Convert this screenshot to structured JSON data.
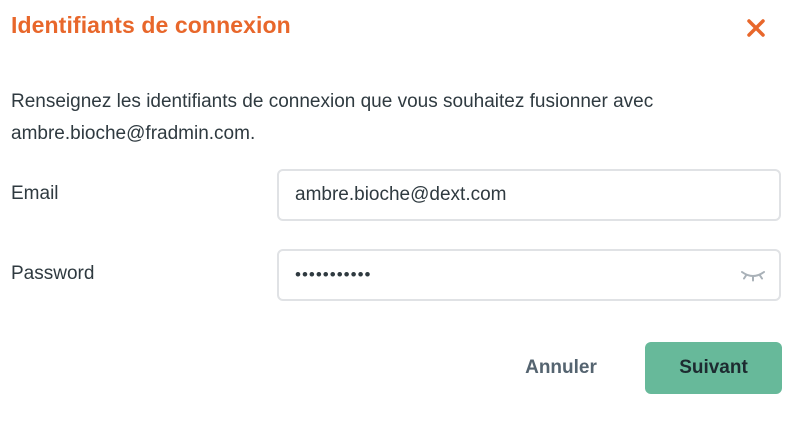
{
  "dialog": {
    "title": "Identifiants de connexion",
    "close_icon": "close-icon",
    "description": "Renseignez les identifiants de connexion que vous souhaitez fusionner avec ambre.bioche@fradmin.com."
  },
  "form": {
    "email_label": "Email",
    "email_value": "ambre.bioche@dext.com",
    "password_label": "Password",
    "password_masked": "•••••••••••",
    "password_toggle_icon": "eye-closed-icon"
  },
  "actions": {
    "cancel_label": "Annuler",
    "next_label": "Suivant"
  },
  "colors": {
    "title": "#e8672b",
    "primary_button": "#67b99a",
    "input_border": "#e0e2e5",
    "text": "#2f3a40"
  }
}
